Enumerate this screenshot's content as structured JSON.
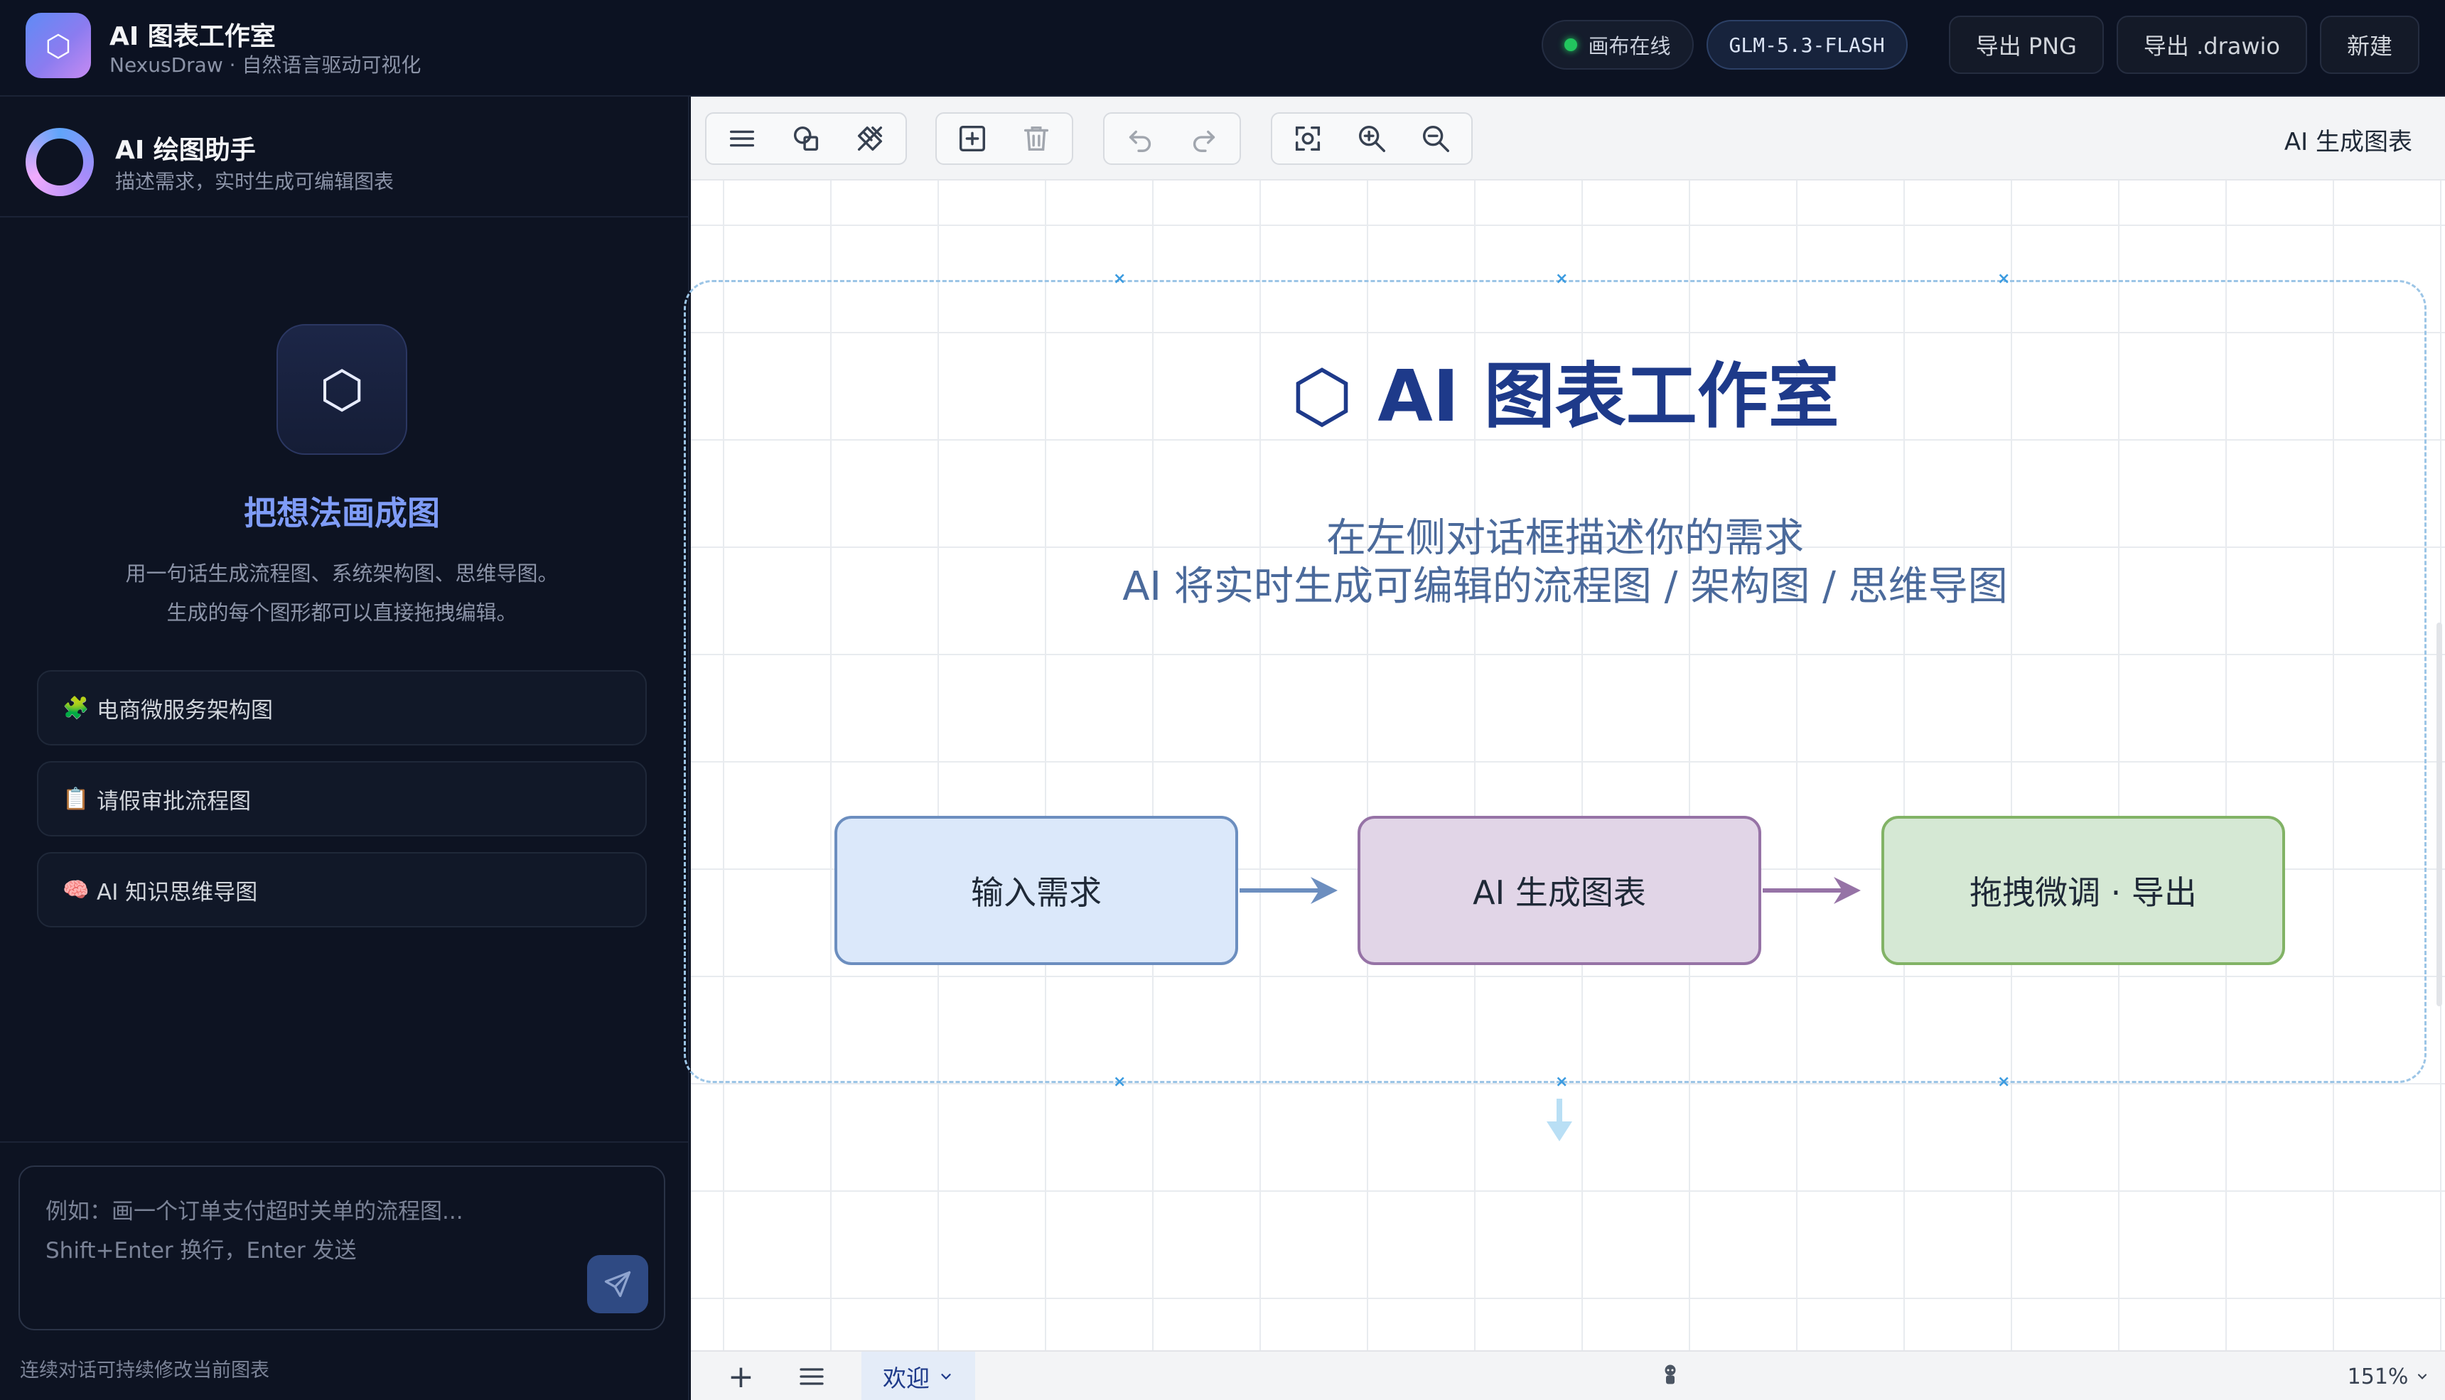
{
  "app": {
    "logo_glyph": "⬡",
    "title": "AI 图表工作室",
    "subtitle": "NexusDraw · 自然语言驱动可视化"
  },
  "topbar": {
    "status_label": "画布在线",
    "status_color": "#22c55e",
    "model_label": "GLM-5.3-FLASH",
    "export_png_label": "导出 PNG",
    "export_drawio_label": "导出 .drawio",
    "new_label": "新建"
  },
  "assistant": {
    "title": "AI 绘图助手",
    "subtitle": "描述需求，实时生成可编辑图表",
    "hero_glyph": "⬡",
    "hero_title": "把想法画成图",
    "hero_desc_line1": "用一句话生成流程图、系统架构图、思维导图。",
    "hero_desc_line2": "生成的每个图形都可以直接拖拽编辑。",
    "suggestions": [
      {
        "emoji": "🧩",
        "label": "电商微服务架构图"
      },
      {
        "emoji": "📋",
        "label": "请假审批流程图"
      },
      {
        "emoji": "🧠",
        "label": "AI 知识思维导图"
      }
    ]
  },
  "composer": {
    "placeholder": "例如：画一个订单支付超时关单的流程图...\nShift+Enter 换行，Enter 发送",
    "value": "",
    "send_icon": "send-icon",
    "hint": "连续对话可持续修改当前图表"
  },
  "canvas": {
    "tag_label": "AI 生成图表",
    "toolbar_icons": [
      "menu-icon",
      "shapes-icon",
      "format-icon",
      "insert-icon",
      "delete-icon",
      "undo-icon",
      "redo-icon",
      "fit-icon",
      "zoom-in-icon",
      "zoom-out-icon"
    ],
    "welcome_title": "⬡ AI 图表工作室",
    "welcome_line1": "在左侧对话框描述你的需求",
    "welcome_line2": "AI 将实时生成可编辑的流程图 / 架构图 / 思维导图",
    "nodes": [
      {
        "label": "输入需求",
        "fill": "#dbe8fa",
        "stroke": "#6c8ebf"
      },
      {
        "label": "AI 生成图表",
        "fill": "#e1d5e7",
        "stroke": "#9673a6"
      },
      {
        "label": "拖拽微调 · 导出",
        "fill": "#d5e8d4",
        "stroke": "#82b366"
      }
    ]
  },
  "footer": {
    "page_tab_label": "欢迎",
    "zoom_label": "151%"
  }
}
